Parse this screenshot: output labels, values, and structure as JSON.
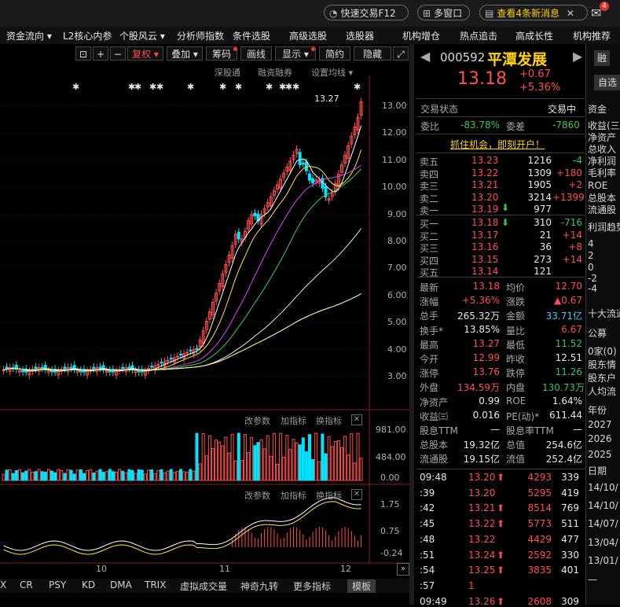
{
  "topbar": {
    "quick_trade": "快速交易F12",
    "multi_window": "多窗口",
    "news": "查看4条新消息",
    "mail_badge": "4"
  },
  "menu": [
    "资金流向 ▾",
    "L2核心内参",
    "个股风云 ▾",
    "分析师指数",
    "条件选股",
    "高级选股",
    "选股器",
    "机构增仓",
    "热点追击",
    "高成长性",
    "机构推荐"
  ],
  "toolbar": {
    "buttons": [
      "复权 ▾",
      "叠加 ▾",
      "筹码",
      "画线",
      "显示 ▾",
      "简约",
      "隐藏"
    ],
    "sublinks": [
      "深股通",
      "融资融券",
      "设置均线 ▾"
    ]
  },
  "price_axis": [
    "13.00",
    "12.00",
    "11.00",
    "10.00",
    "9.00",
    "8.00",
    "7.00",
    "6.00",
    "5.00",
    "4.00",
    "3.00"
  ],
  "max_label": "13.27",
  "vol_panel": {
    "links": [
      "改参数",
      "加指标",
      "换指标"
    ],
    "axis": [
      "981.00",
      "484.00",
      "0.00"
    ]
  },
  "macd_panel": {
    "links": [
      "改参数",
      "加指标",
      "换指标"
    ],
    "axis": [
      "1.75",
      "0.75",
      "-0.24"
    ]
  },
  "x_labels": [
    "10",
    "11",
    "12"
  ],
  "indicator_tabs": [
    "X",
    "CR",
    "PSY",
    "KD",
    "DMA",
    "TRIX",
    "虚拟成交量",
    "神奇九转",
    "更多指标",
    "模板"
  ],
  "stock": {
    "code": "000592",
    "name": "平潭发展",
    "price": "13.18",
    "change": "+0.67",
    "change_pct": "+5.36%",
    "btn_finance": "融",
    "btn_self": "自选"
  },
  "status": {
    "label": "交易状态",
    "value": "交易中"
  },
  "ratio": {
    "wb_label": "委比",
    "wb": "-83.78%",
    "wc_label": "委差",
    "wc": "-7860"
  },
  "promo": "抓住机会，即刻开户！",
  "asks": [
    {
      "label": "卖五",
      "price": "13.23",
      "vol": "1216",
      "chg": "-4"
    },
    {
      "label": "卖四",
      "price": "13.22",
      "vol": "1309",
      "chg": "+180"
    },
    {
      "label": "卖三",
      "price": "13.21",
      "vol": "1905",
      "chg": "+2"
    },
    {
      "label": "卖二",
      "price": "13.20",
      "vol": "3214",
      "chg": "+1399"
    },
    {
      "label": "卖一",
      "price": "13.19",
      "vol": "977",
      "chg": ""
    }
  ],
  "bids": [
    {
      "label": "买一",
      "price": "13.18",
      "vol": "310",
      "chg": "-716"
    },
    {
      "label": "买二",
      "price": "13.17",
      "vol": "21",
      "chg": "+14"
    },
    {
      "label": "买三",
      "price": "13.16",
      "vol": "36",
      "chg": "+8"
    },
    {
      "label": "买四",
      "price": "13.15",
      "vol": "273",
      "chg": "+14"
    },
    {
      "label": "买五",
      "price": "13.14",
      "vol": "121",
      "chg": ""
    }
  ],
  "stats": [
    {
      "l1": "最新",
      "v1": "13.18",
      "c1": "red",
      "l2": "均价",
      "v2": "12.70",
      "c2": "red"
    },
    {
      "l1": "涨幅",
      "v1": "+5.36%",
      "c1": "red",
      "l2": "涨跌",
      "v2": "▲0.67",
      "c2": "red"
    },
    {
      "l1": "总手",
      "v1": "265.32万",
      "c1": "white",
      "l2": "金额",
      "v2": "33.71亿",
      "c2": "cyan"
    },
    {
      "l1": "换手*",
      "v1": "13.85%",
      "c1": "white",
      "l2": "量比",
      "v2": "6.67",
      "c2": "red"
    },
    {
      "l1": "最高",
      "v1": "13.27",
      "c1": "red",
      "l2": "最低",
      "v2": "11.52",
      "c2": "green"
    },
    {
      "l1": "今开",
      "v1": "12.99",
      "c1": "red",
      "l2": "昨收",
      "v2": "12.51",
      "c2": "white"
    },
    {
      "l1": "涨停",
      "v1": "13.76",
      "c1": "red",
      "l2": "跌停",
      "v2": "11.26",
      "c2": "green"
    },
    {
      "l1": "外盘",
      "v1": "134.59万",
      "c1": "red",
      "l2": "内盘",
      "v2": "130.73万",
      "c2": "green"
    },
    {
      "l1": "净资产",
      "v1": "0.99",
      "c1": "white",
      "l2": "ROE",
      "v2": "1.64%",
      "c2": "white"
    },
    {
      "l1": "收益㈢",
      "v1": "0.016",
      "c1": "white",
      "l2": "PE(动)*",
      "v2": "611.44",
      "c2": "white"
    },
    {
      "l1": "股息TTM",
      "v1": "—",
      "c1": "white",
      "l2": "股息率TTM",
      "v2": "—",
      "c2": "white"
    },
    {
      "l1": "总股本",
      "v1": "19.32亿",
      "c1": "white",
      "l2": "总值",
      "v2": "254.6亿",
      "c2": "white"
    },
    {
      "l1": "流通股",
      "v1": "19.15亿",
      "c1": "white",
      "l2": "流值",
      "v2": "252.4亿",
      "c2": "white"
    }
  ],
  "ticks": [
    {
      "t": "09:48",
      "p": "13.20",
      "up": true,
      "v": "4293",
      "n": "339"
    },
    {
      "t": ":39",
      "p": "13.20",
      "up": false,
      "v": "5295",
      "n": "419"
    },
    {
      "t": ":42",
      "p": "13.21",
      "up": true,
      "v": "8514",
      "n": "769"
    },
    {
      "t": ":45",
      "p": "13.22",
      "up": true,
      "v": "5773",
      "n": "511"
    },
    {
      "t": ":48",
      "p": "13.22",
      "up": false,
      "v": "4429",
      "n": "477"
    },
    {
      "t": ":51",
      "p": "13.24",
      "up": true,
      "v": "2592",
      "n": "330"
    },
    {
      "t": ":54",
      "p": "13.25",
      "up": true,
      "v": "3835",
      "n": "401"
    },
    {
      "t": ":57",
      "p": "1",
      "up": false,
      "v": "",
      "n": ""
    },
    {
      "t": "09:49",
      "p": "13.26",
      "up": true,
      "v": "2608",
      "n": "309"
    }
  ],
  "far_right": [
    "资金",
    "收益(三",
    "净资产",
    "总收入",
    "净利润",
    "毛利率",
    "ROE",
    "总股本",
    "流通股",
    "利润趋势",
    "4",
    "2",
    "0",
    "-2",
    "-4",
    "十大流通",
    "公募",
    "0家(0)",
    "股东情",
    "股东户",
    "人均流",
    "年份",
    "2027",
    "2026",
    "2025",
    "日期",
    "14/10/",
    "14/10/",
    "14/07/",
    "13/04/",
    "13/01/",
    "—"
  ],
  "colors": {
    "up": "#ff4d4d",
    "down": "#00e5ff",
    "ma5": "#ffffff",
    "ma10": "#ffe44d",
    "ma20": "#e040fb",
    "ma30": "#39d353",
    "ma60": "#e6e6e6",
    "ma120": "#4aa3ff",
    "ma250": "#ffff80"
  }
}
